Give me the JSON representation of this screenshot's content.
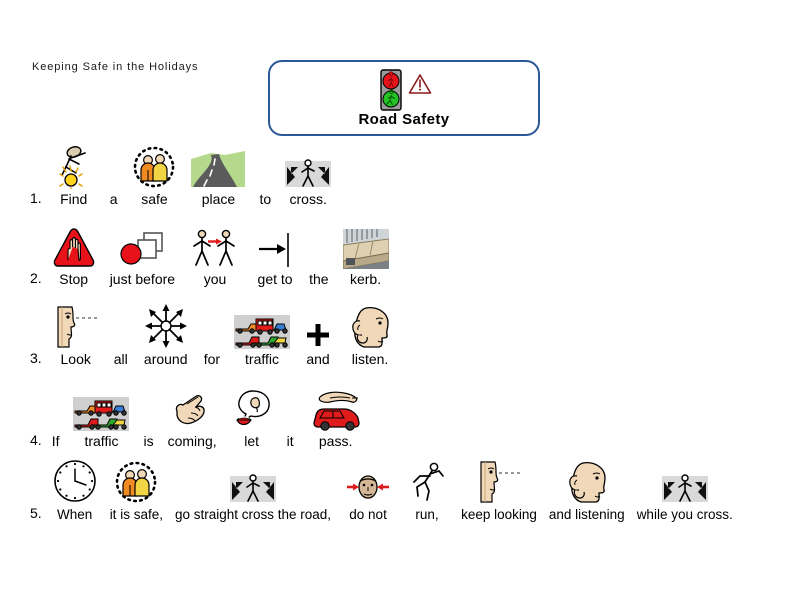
{
  "document": {
    "title": "Keeping Safe in the Holidays"
  },
  "header": {
    "title": "Road Safety",
    "symbol": "traffic-light-warning-symbol",
    "border_color": "#2b5797"
  },
  "lines": [
    {
      "number": "1.",
      "cells": [
        {
          "word": "Find",
          "symbol": "find-person-light-icon"
        },
        {
          "word": "a",
          "symbol": ""
        },
        {
          "word": "safe",
          "symbol": "two-people-dotted-circle-icon"
        },
        {
          "word": "place",
          "symbol": "road-landscape-icon"
        },
        {
          "word": "to",
          "symbol": ""
        },
        {
          "word": "cross.",
          "symbol": "pedestrian-crossing-icon"
        }
      ]
    },
    {
      "number": "2.",
      "cells": [
        {
          "word": "Stop",
          "symbol": "red-triangle-hand-stop-icon"
        },
        {
          "word": "just before",
          "symbol": "circle-before-squares-icon"
        },
        {
          "word": "you",
          "symbol": "two-figures-arrow-icon"
        },
        {
          "word": "get to",
          "symbol": "arrow-to-line-icon"
        },
        {
          "word": "the",
          "symbol": ""
        },
        {
          "word": "kerb.",
          "symbol": "kerb-pavement-icon"
        }
      ]
    },
    {
      "number": "3.",
      "cells": [
        {
          "word": "Look",
          "symbol": "face-looking-profile-icon"
        },
        {
          "word": "all",
          "symbol": ""
        },
        {
          "word": "around",
          "symbol": "radiating-arrows-icon"
        },
        {
          "word": "for",
          "symbol": ""
        },
        {
          "word": "traffic",
          "symbol": "traffic-vehicles-icon"
        },
        {
          "word": "and",
          "symbol": "plus-sign-icon"
        },
        {
          "word": "listen.",
          "symbol": "head-hand-to-ear-icon"
        }
      ]
    },
    {
      "number": "4.",
      "cells": [
        {
          "word": "If",
          "symbol": ""
        },
        {
          "word": "traffic",
          "symbol": "traffic-vehicles-icon"
        },
        {
          "word": "is",
          "symbol": ""
        },
        {
          "word": "coming,",
          "symbol": "pointing-hand-coming-icon"
        },
        {
          "word": "let",
          "symbol": "mouth-speech-let-icon"
        },
        {
          "word": "it",
          "symbol": ""
        },
        {
          "word": "pass.",
          "symbol": "hand-over-red-car-icon"
        }
      ]
    },
    {
      "number": "5.",
      "cells": [
        {
          "word": "When",
          "symbol": "clock-icon"
        },
        {
          "word": "it is safe,",
          "symbol": "two-people-dotted-circle-icon"
        },
        {
          "word": "go straight cross the road,",
          "symbol": "pedestrian-crossing-icon"
        },
        {
          "word": "do not",
          "symbol": "face-red-arrows-do-not-icon"
        },
        {
          "word": "run,",
          "symbol": "running-figure-icon"
        },
        {
          "word": "keep looking",
          "symbol": "face-looking-profile-icon"
        },
        {
          "word": "and listening",
          "symbol": "head-hand-to-ear-icon"
        },
        {
          "word": "while you cross.",
          "symbol": "pedestrian-crossing-icon"
        }
      ]
    }
  ],
  "colors": {
    "traffic_red": "#e8131a",
    "traffic_green": "#22c322",
    "skin": "#f0d8b8",
    "grass": "#b5d98c",
    "road_gray": "#5b5b5b",
    "crossing_bg": "#d9d9d9",
    "car_red": "#e01b1b",
    "border_blue": "#2b5797"
  }
}
